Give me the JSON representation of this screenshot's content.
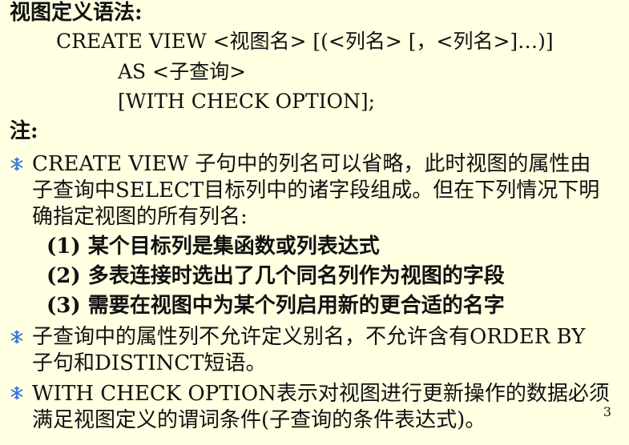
{
  "slide": {
    "heading": "视图定义语法:",
    "syntax": {
      "line1": "CREATE  VIEW <视图名> [(<列名> [，<列名>]…)]",
      "line2": "AS <子查询>",
      "line3": "[WITH  CHECK  OPTION];"
    },
    "note_label": "注:",
    "bullets": [
      {
        "lines": [
          "CREATE  VIEW 子句中的列名可以省略，此时视图的属性由",
          "子查询中SELECT目标列中的诸字段组成。但在下列情况下明",
          "确指定视图的所有列名:"
        ],
        "sub_items": [
          "(1) 某个目标列是集函数或列表达式",
          "(2) 多表连接时选出了几个同名列作为视图的字段",
          "(3) 需要在视图中为某个列启用新的更合适的名字"
        ]
      },
      {
        "lines": [
          "子查询中的属性列不允许定义别名，不允许含有ORDER BY",
          "子句和DISTINCT短语。"
        ]
      },
      {
        "lines": [
          "WITH  CHECK  OPTION表示对视图进行更新操作的数据必须",
          "满足视图定义的谓词条件(子查询的条件表达式)。"
        ]
      }
    ],
    "page_number": "3",
    "bullet_color": "#3a78d8",
    "bullet_icon": "snowflake-bullet-icon"
  }
}
